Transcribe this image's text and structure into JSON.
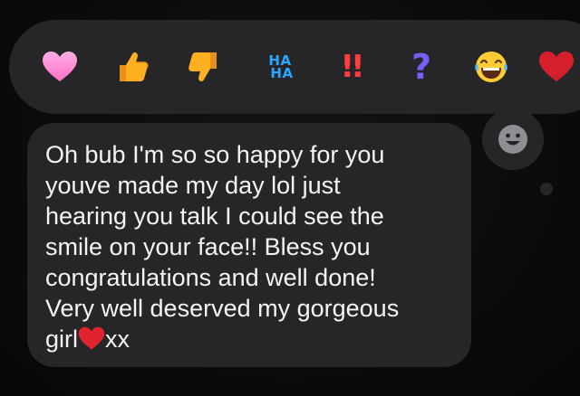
{
  "reaction_bar": {
    "items": [
      {
        "name": "heart",
        "icon": "heart-icon",
        "color": "#ff8ad4"
      },
      {
        "name": "like",
        "icon": "thumbs-up-icon",
        "color": "#ffb020"
      },
      {
        "name": "dislike",
        "icon": "thumbs-down-icon",
        "color": "#ffb020"
      },
      {
        "name": "haha",
        "label_top": "HA",
        "label_bottom": "HA",
        "color": "#2aa8ff"
      },
      {
        "name": "emphasize",
        "label": "!!",
        "color": "#ff3d3d"
      },
      {
        "name": "question",
        "label": "?",
        "color": "#7b5cf5"
      },
      {
        "name": "laughing",
        "icon": "laughing-face-icon"
      },
      {
        "name": "red-heart",
        "icon": "red-heart-icon",
        "color": "#e0232e"
      }
    ],
    "add_emoji_icon": "smiley-icon"
  },
  "message": {
    "text": "Oh bub I'm so so happy for you\nyouve made my day lol just\nhearing you talk I could see the\nsmile on your face!! Bless you\ncongratulations and well done!\nVery well deserved my gorgeous\ngirl",
    "suffix": "xx",
    "inline_emoji": "red-heart-icon"
  },
  "colors": {
    "bubble": "#262628",
    "background": "#0b0b0d",
    "text": "#f4f4f6"
  }
}
